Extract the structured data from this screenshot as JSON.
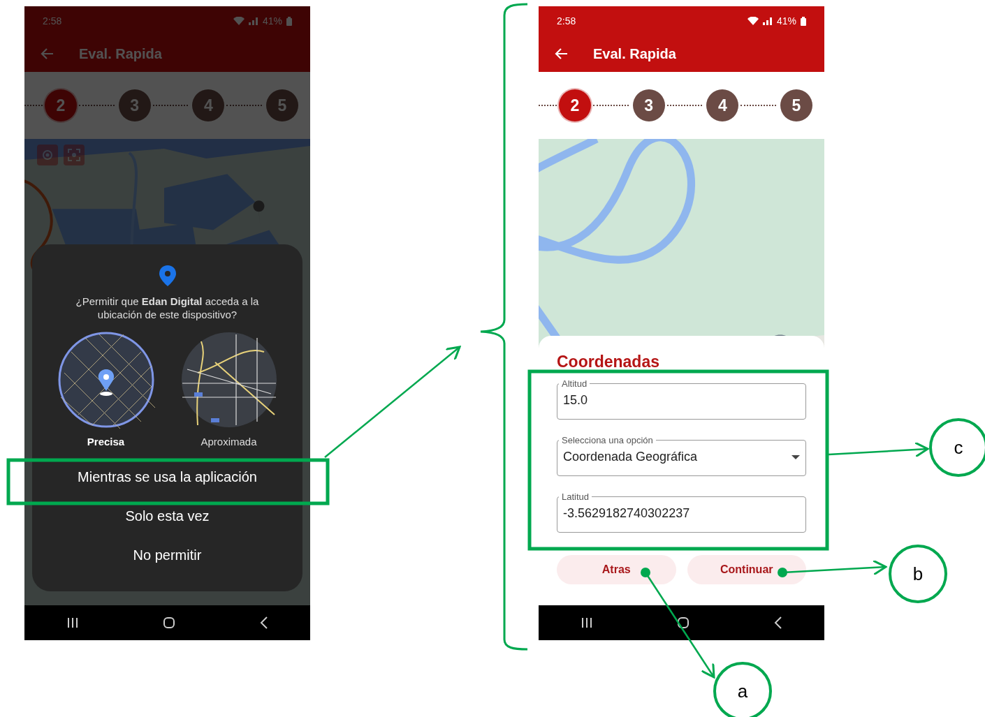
{
  "screens": [
    {
      "kind": "permission",
      "status_bar": {
        "time": "2:58",
        "battery": "41%"
      },
      "app_bar": {
        "title": "Eval. Rapida"
      },
      "steps": [
        {
          "label": "2",
          "selected": true
        },
        {
          "label": "3",
          "selected": false
        },
        {
          "label": "4",
          "selected": false
        },
        {
          "label": "5",
          "selected": false
        }
      ],
      "dialog": {
        "prompt": "¿Permitir que **Edan Digital** acceda a la ubicación de este dispositivo?",
        "options": [
          {
            "label": "Precisa",
            "selected": true
          },
          {
            "label": "Aproximada",
            "selected": false
          }
        ],
        "buttons": [
          "Mientras se usa la aplicación",
          "Solo esta vez",
          "No permitir"
        ]
      }
    },
    {
      "kind": "form",
      "status_bar": {
        "time": "2:58",
        "battery": "41%"
      },
      "app_bar": {
        "title": "Eval. Rapida"
      },
      "steps": [
        {
          "label": "2",
          "selected": true
        },
        {
          "label": "3",
          "selected": false
        },
        {
          "label": "4",
          "selected": false
        },
        {
          "label": "5",
          "selected": false
        }
      ],
      "sheet": {
        "title": "Coordenadas",
        "fields": [
          {
            "kind": "text",
            "label": "Altitud",
            "value": "15.0"
          },
          {
            "kind": "select",
            "label": "Selecciona una opción",
            "value": "Coordenada Geográfica"
          },
          {
            "kind": "text",
            "label": "Latitud",
            "value": "-3.5629182740302237"
          }
        ],
        "buttons": [
          "Atras",
          "Continuar"
        ]
      }
    }
  ],
  "callouts": [
    {
      "label": "a"
    },
    {
      "label": "b"
    },
    {
      "label": "c"
    }
  ]
}
